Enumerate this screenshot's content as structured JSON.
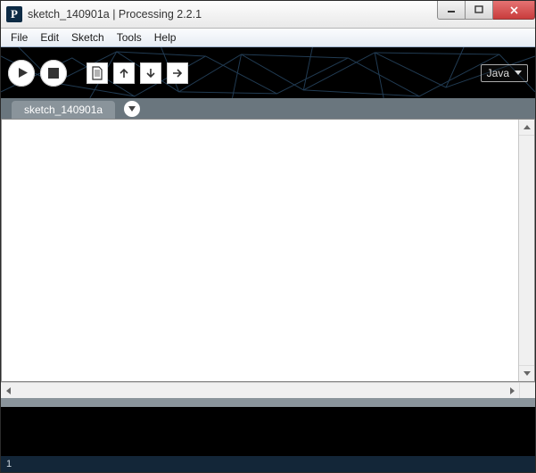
{
  "window": {
    "title": "sketch_140901a | Processing 2.2.1",
    "app_icon_letter": "P"
  },
  "menubar": {
    "items": [
      "File",
      "Edit",
      "Sketch",
      "Tools",
      "Help"
    ]
  },
  "toolbar": {
    "mode_label": "Java"
  },
  "tabs": {
    "active": "sketch_140901a"
  },
  "statusbar": {
    "line_number": "1"
  }
}
